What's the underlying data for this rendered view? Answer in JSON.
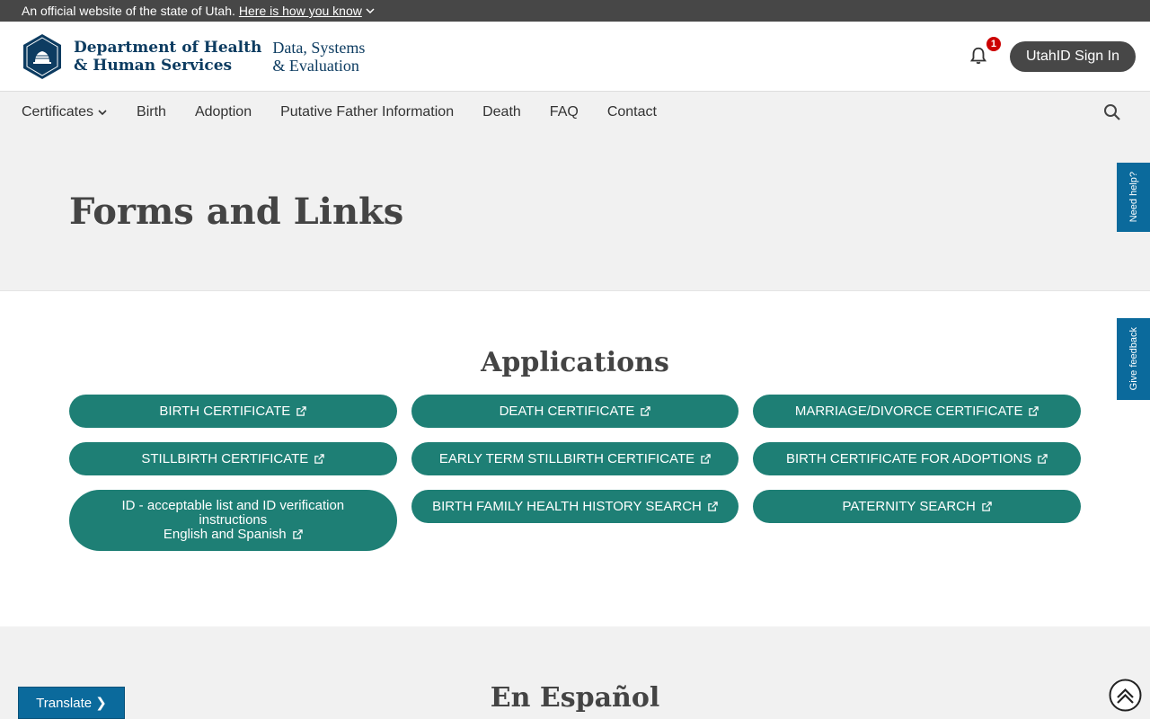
{
  "gov_banner": {
    "text": "An official website of the state of Utah.",
    "link": "Here is how you know"
  },
  "header": {
    "agency_line1": "Department of Health",
    "agency_line2": "& Human Services",
    "subagency_line1": "Data, Systems",
    "subagency_line2": "& Evaluation",
    "notification_count": "1",
    "signin_label": "UtahID Sign In"
  },
  "nav": {
    "items": [
      "Certificates",
      "Birth",
      "Adoption",
      "Putative Father Information",
      "Death",
      "FAQ",
      "Contact"
    ]
  },
  "hero": {
    "title": "Forms and Links"
  },
  "applications": {
    "heading": "Applications",
    "links": [
      "BIRTH CERTIFICATE",
      "DEATH CERTIFICATE",
      "MARRIAGE/DIVORCE CERTIFICATE",
      "STILLBIRTH CERTIFICATE",
      "EARLY TERM STILLBIRTH CERTIFICATE",
      "BIRTH CERTIFICATE FOR ADOPTIONS",
      "ID - acceptable list and ID verification instructions",
      "BIRTH FAMILY HEALTH HISTORY SEARCH",
      "PATERNITY SEARCH"
    ],
    "id_link_line2": "English and Spanish"
  },
  "espanol": {
    "heading": "En Español"
  },
  "side_tabs": {
    "help": "Need help?",
    "feedback": "Give feedback"
  },
  "translate": {
    "label": "Translate ❯"
  },
  "colors": {
    "accent": "#1e7f75",
    "banner": "#474747",
    "tab_blue": "#0b6a9c",
    "nav_bg": "#f1f1f1"
  }
}
